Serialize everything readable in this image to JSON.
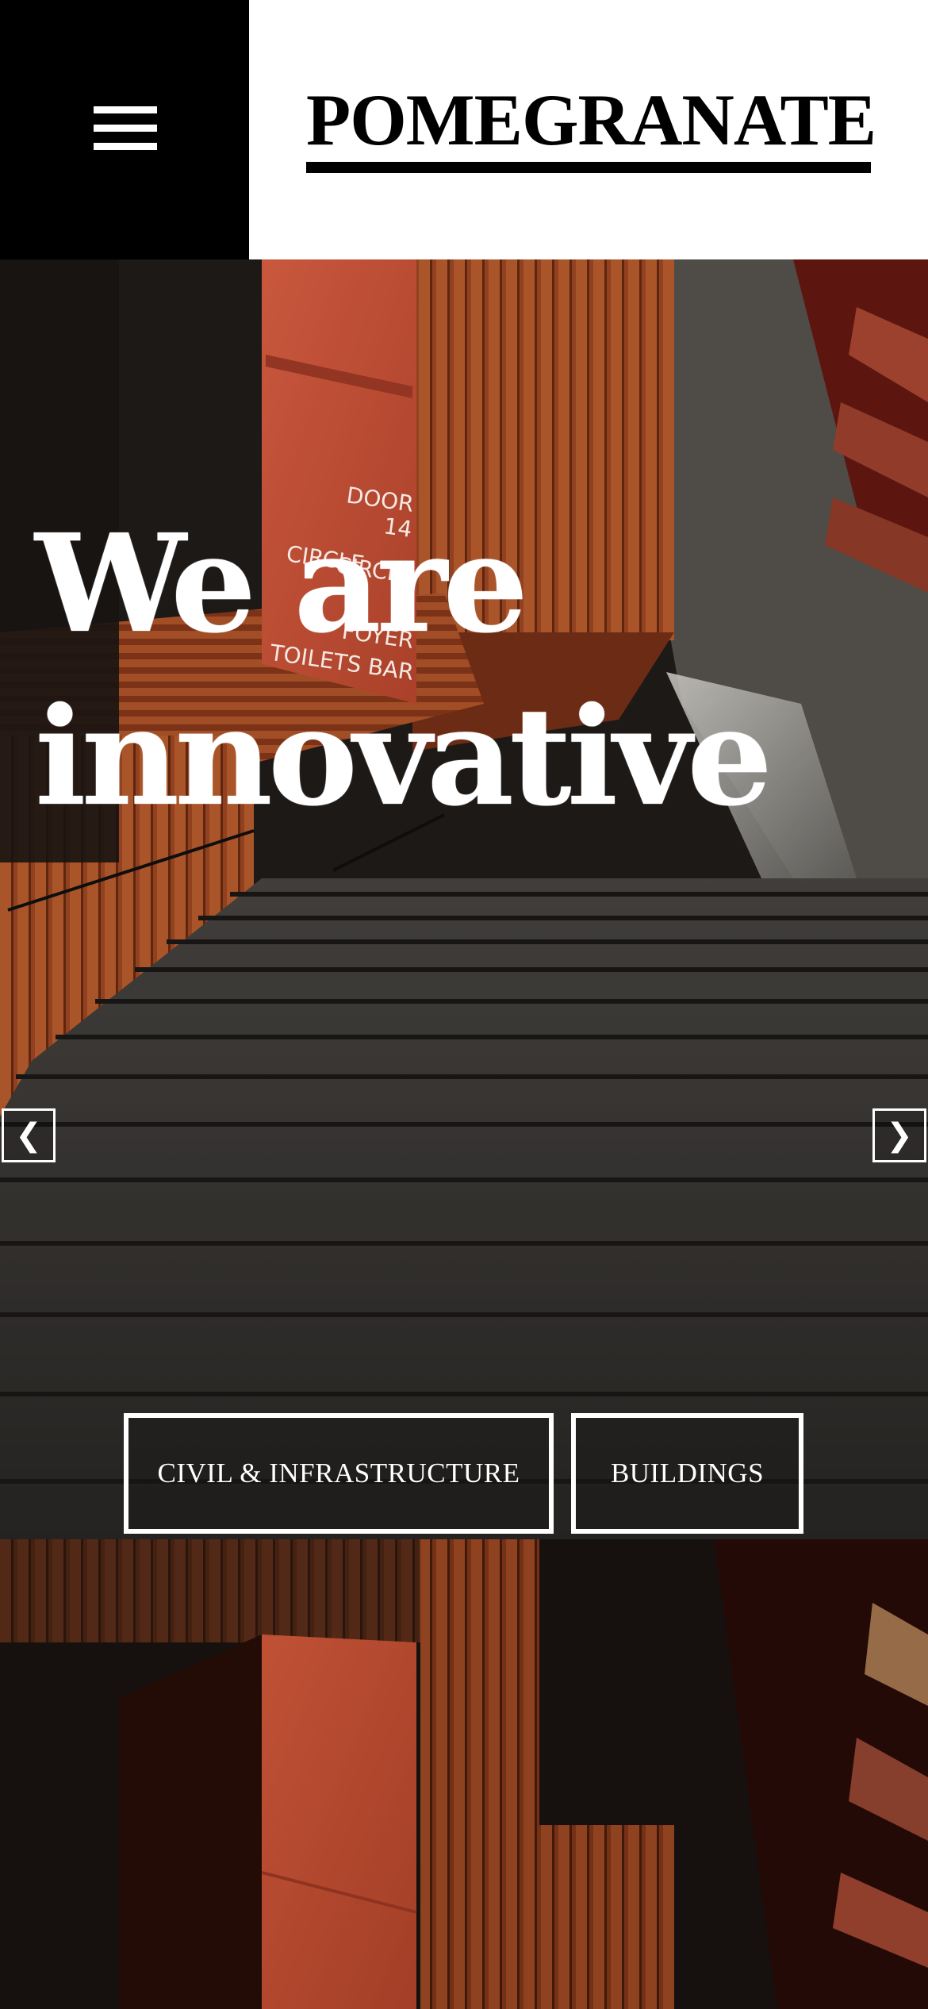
{
  "header": {
    "menu_icon": "hamburger-menu-icon",
    "logo_text": "POMEGRANATE"
  },
  "hero": {
    "headline_line1": "We are",
    "headline_line2": "innovative",
    "prev_arrow": "❮",
    "next_arrow": "❯",
    "buttons": [
      "CIVIL & INFRASTRUCTURE",
      "BUILDINGS"
    ],
    "sign_text": [
      "DOOR",
      "14",
      "CIRCLE",
      "CIRCLE",
      "FOYER",
      "TOILETS  BAR"
    ]
  },
  "colors": {
    "header_menu_bg": "#000000",
    "header_bg": "#ffffff",
    "accent_orange": "#d9573a",
    "wood": "#b4552a"
  }
}
